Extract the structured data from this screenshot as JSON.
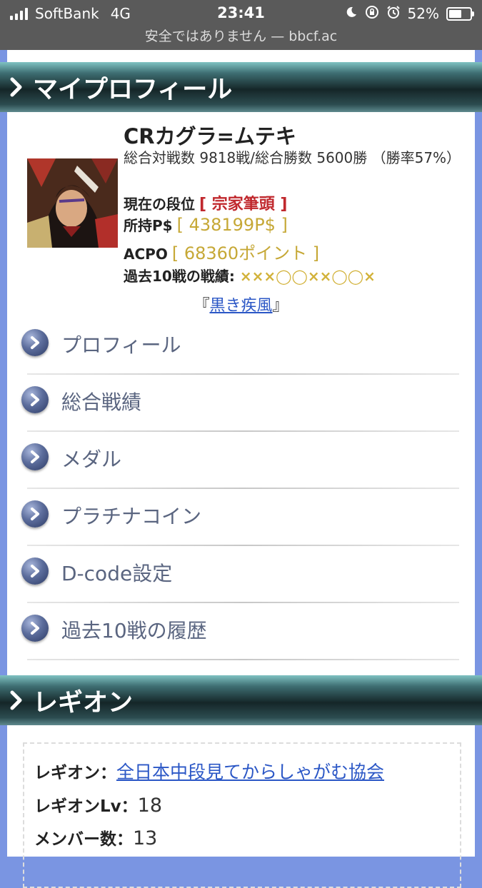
{
  "status_bar": {
    "carrier": "SoftBank",
    "network": "4G",
    "time": "23:41",
    "battery": "52%",
    "battery_level": 0.52,
    "url": "安全ではありません — bbcf.ac"
  },
  "profile_section": {
    "header": "マイプロフィール",
    "name": "CRカグラ=ムテキ",
    "stats": "総合対戦数 9818戦/総合勝数 5600勝 （勝率57%）",
    "rank_label": "現在の段位",
    "rank_value": "[ 宗家筆頭 ]",
    "ps_label": "所持P$",
    "ps_value": "[ 438199P$ ]",
    "acpo_label": "ACPO",
    "acpo_value": "[ 68360ポイント ]",
    "results_label": "過去10戦の戦績:",
    "results_value": "×××◯◯××◯◯×",
    "title_open": "『",
    "title_link": "黒き疾風",
    "title_close": "』"
  },
  "menu": {
    "items": [
      {
        "label": "プロフィール",
        "icon": "chevron-right-circle-icon"
      },
      {
        "label": "総合戦績",
        "icon": "chevron-right-circle-icon"
      },
      {
        "label": "メダル",
        "icon": "chevron-right-circle-icon"
      },
      {
        "label": "プラチナコイン",
        "icon": "chevron-right-circle-icon"
      },
      {
        "label": "D-code設定",
        "icon": "chevron-right-circle-icon"
      },
      {
        "label": "過去10戦の履歴",
        "icon": "chevron-right-circle-icon"
      }
    ]
  },
  "legion_section": {
    "header": "レギオン",
    "legion_label": "レギオン：",
    "legion_name": "全日本中段見てからしゃがむ協会",
    "level_label": "レギオンLv：",
    "level_value": "18",
    "members_label": "メンバー数：",
    "members_value": "13"
  },
  "colors": {
    "page_background": "#7a95e2",
    "rank_red": "#c0282d",
    "value_gold": "#c6a836",
    "link_blue": "#2b57c6"
  }
}
